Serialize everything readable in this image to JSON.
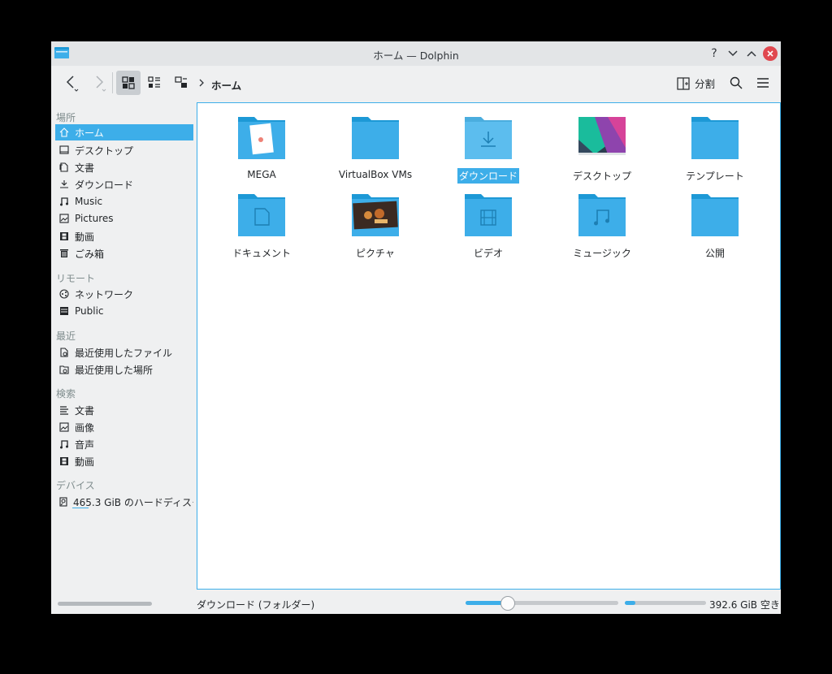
{
  "window": {
    "title": "ホーム — Dolphin"
  },
  "titlebar": {
    "help": "?",
    "minimize": "⌄",
    "maximize": "⌃"
  },
  "toolbar": {
    "breadcrumb": "ホーム",
    "split_label": "分割"
  },
  "sidebar": {
    "sections": [
      {
        "title": "場所",
        "items": [
          {
            "label": "ホーム",
            "icon": "home-icon",
            "selected": true
          },
          {
            "label": "デスクトップ",
            "icon": "desktop-icon"
          },
          {
            "label": "文書",
            "icon": "documents-icon"
          },
          {
            "label": "ダウンロード",
            "icon": "download-icon"
          },
          {
            "label": "Music",
            "icon": "music-icon"
          },
          {
            "label": "Pictures",
            "icon": "pictures-icon"
          },
          {
            "label": "動画",
            "icon": "video-icon"
          },
          {
            "label": "ごみ箱",
            "icon": "trash-icon"
          }
        ]
      },
      {
        "title": "リモート",
        "items": [
          {
            "label": "ネットワーク",
            "icon": "network-icon"
          },
          {
            "label": "Public",
            "icon": "server-icon"
          }
        ]
      },
      {
        "title": "最近",
        "items": [
          {
            "label": "最近使用したファイル",
            "icon": "recent-file-icon"
          },
          {
            "label": "最近使用した場所",
            "icon": "recent-folder-icon"
          }
        ]
      },
      {
        "title": "検索",
        "items": [
          {
            "label": "文書",
            "icon": "text-icon"
          },
          {
            "label": "画像",
            "icon": "image-icon"
          },
          {
            "label": "音声",
            "icon": "audio-icon"
          },
          {
            "label": "動画",
            "icon": "video-icon"
          }
        ]
      },
      {
        "title": "デバイス",
        "items": [
          {
            "label": "465.3 GiB のハードディスク",
            "icon": "harddisk-icon"
          }
        ]
      }
    ]
  },
  "files": [
    {
      "name": "MEGA",
      "icon": "mega-folder-icon"
    },
    {
      "name": "VirtualBox VMs",
      "icon": "folder-icon"
    },
    {
      "name": "ダウンロード",
      "icon": "download-folder-icon",
      "selected": true
    },
    {
      "name": "デスクトップ",
      "icon": "desktop-thumbnail-icon"
    },
    {
      "name": "テンプレート",
      "icon": "folder-icon"
    },
    {
      "name": "ドキュメント",
      "icon": "documents-folder-icon"
    },
    {
      "name": "ピクチャ",
      "icon": "pictures-folder-icon"
    },
    {
      "name": "ビデオ",
      "icon": "videos-folder-icon"
    },
    {
      "name": "ミュージック",
      "icon": "music-folder-icon"
    },
    {
      "name": "公開",
      "icon": "folder-icon"
    }
  ],
  "status": {
    "selection": "ダウンロード (フォルダー)",
    "zoom_level": 0.27,
    "disk_used_fraction": 0.13,
    "free_space": "392.6 GiB 空き"
  },
  "colors": {
    "accent": "#3daee9",
    "folder_back": "#1d99d6",
    "folder_front": "#3daee9",
    "close": "#e0484f"
  }
}
